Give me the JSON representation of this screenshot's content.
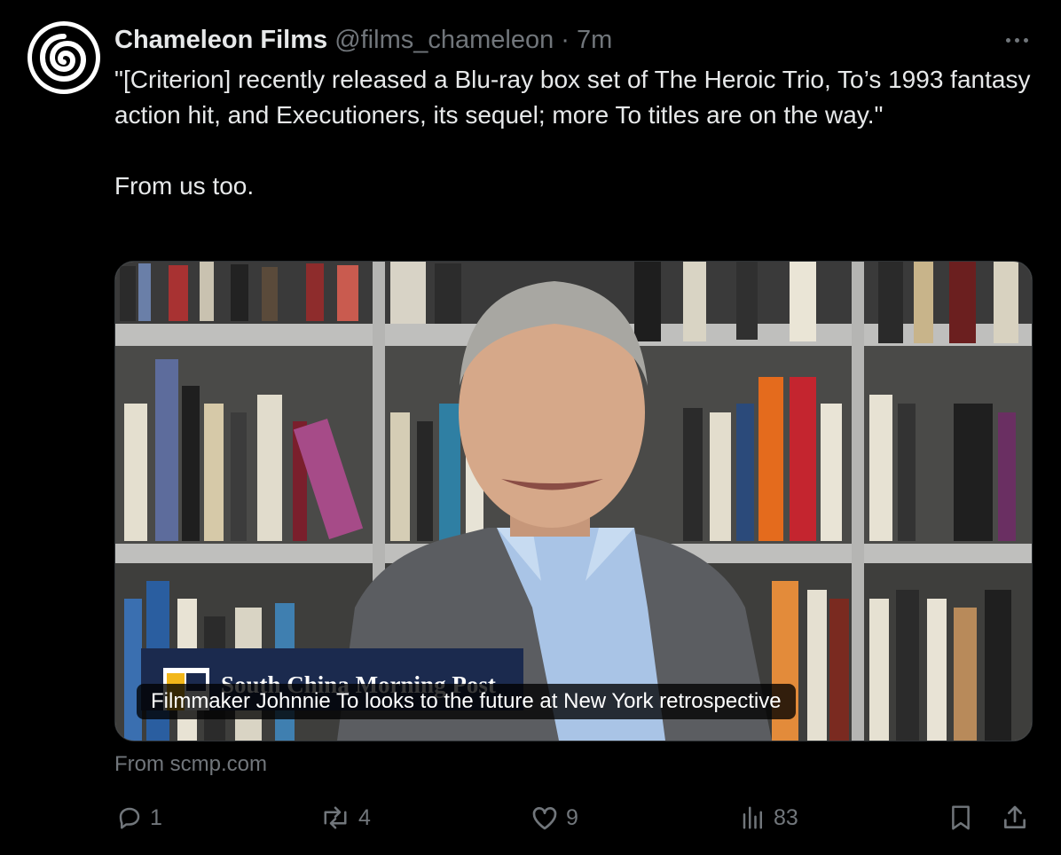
{
  "tweet": {
    "display_name": "Chameleon Films",
    "handle": "@films_chameleon",
    "separator": "·",
    "time": "7m",
    "text": "\"[Criterion] recently released a Blu-ray box set of The Heroic Trio, To’s 1993 fantasy action hit, and Executioners, its sequel; more To titles are on the way.\"\n\nFrom us too."
  },
  "card": {
    "image_logo_text": "South China Morning Post",
    "caption": "Filmmaker Johnnie To looks to the future at New York retrospective",
    "source": "From scmp.com"
  },
  "actions": {
    "replies": "1",
    "reposts": "4",
    "likes": "9",
    "views": "83"
  },
  "icons": {
    "avatar": "chameleon-swirl-icon",
    "more": "more-options-icon",
    "reply": "reply-icon",
    "repost": "repost-icon",
    "like": "heart-icon",
    "views": "views-icon",
    "bookmark": "bookmark-icon",
    "share": "share-icon"
  },
  "colors": {
    "background": "#000000",
    "primary_text": "#e7e9ea",
    "secondary_text": "#71767b",
    "border": "#2f3336",
    "scmp_navy": "#1b2a4e",
    "scmp_yellow": "#f2b71a"
  }
}
